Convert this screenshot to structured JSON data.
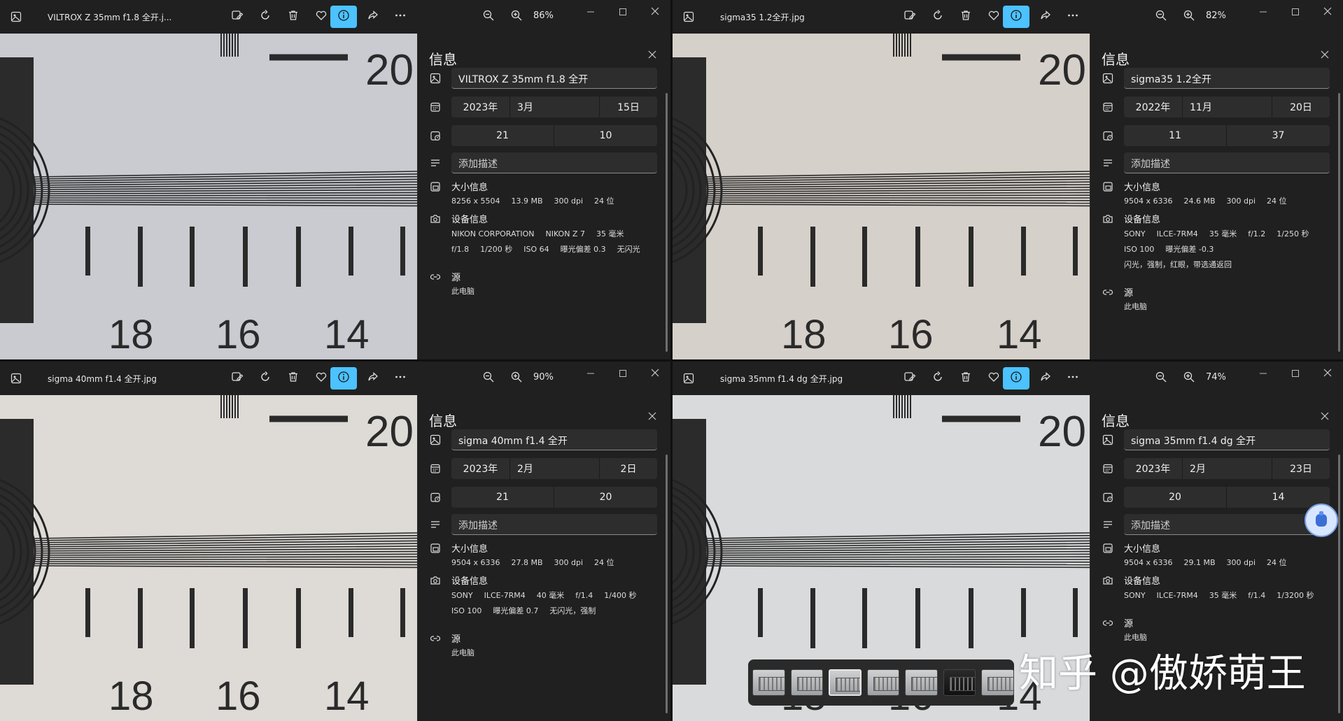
{
  "colors": {
    "accent": "#4cc2ff",
    "window_bg": "#202020",
    "field_bg": "#2d2d2d"
  },
  "windows": [
    {
      "id": "w1",
      "filename": "VILTROX Z 35mm f1.8 全开.j...",
      "zoom": "86%",
      "panel_title": "信息",
      "title_value": "VILTROX Z 35mm f1.8 全开",
      "date": {
        "year": "2023年",
        "month": "3月",
        "day": "15日"
      },
      "time": {
        "hour": "21",
        "minute": "10"
      },
      "description_placeholder": "添加描述",
      "size_title": "大小信息",
      "size_line": [
        "8256 x 5504",
        "13.9 MB",
        "300 dpi",
        "24 位"
      ],
      "device_title": "设备信息",
      "device_lines": [
        [
          "NIKON CORPORATION",
          "NIKON Z 7",
          "35 毫米"
        ],
        [
          "f/1.8",
          "1/200 秒",
          "ISO 64",
          "曝光偏差 0.3",
          "无闪光"
        ]
      ],
      "source_title": "源",
      "source_value": "此电脑",
      "photo_tint": "#c9cbd1",
      "chart_labels": [
        "20",
        "18",
        "16",
        "14"
      ]
    },
    {
      "id": "w2",
      "filename": "sigma35 1.2全开.jpg",
      "zoom": "82%",
      "panel_title": "信息",
      "title_value": "sigma35 1.2全开",
      "date": {
        "year": "2022年",
        "month": "11月",
        "day": "20日"
      },
      "time": {
        "hour": "11",
        "minute": "37"
      },
      "description_placeholder": "添加描述",
      "size_title": "大小信息",
      "size_line": [
        "9504 x 6336",
        "24.6 MB",
        "300 dpi",
        "24 位"
      ],
      "device_title": "设备信息",
      "device_lines": [
        [
          "SONY",
          "ILCE-7RM4",
          "35 毫米",
          "f/1.2",
          "1/250 秒"
        ],
        [
          "ISO 100",
          "曝光偏差 -0.3"
        ],
        [
          "闪光，强制，红眼，带选通返回"
        ]
      ],
      "source_title": "源",
      "source_value": "此电脑",
      "photo_tint": "#d6d0ca",
      "chart_labels": [
        "20",
        "18",
        "16",
        "14"
      ]
    },
    {
      "id": "w3",
      "filename": "sigma 40mm f1.4 全开.jpg",
      "zoom": "90%",
      "panel_title": "信息",
      "title_value": "sigma 40mm f1.4 全开",
      "date": {
        "year": "2023年",
        "month": "2月",
        "day": "2日"
      },
      "time": {
        "hour": "21",
        "minute": "20"
      },
      "description_placeholder": "添加描述",
      "size_title": "大小信息",
      "size_line": [
        "9504 x 6336",
        "27.8 MB",
        "300 dpi",
        "24 位"
      ],
      "device_title": "设备信息",
      "device_lines": [
        [
          "SONY",
          "ILCE-7RM4",
          "40 毫米",
          "f/1.4",
          "1/400 秒"
        ],
        [
          "ISO 100",
          "曝光偏差 0.7",
          "无闪光，强制"
        ]
      ],
      "source_title": "源",
      "source_value": "此电脑",
      "photo_tint": "#dedad6",
      "chart_labels": [
        "20",
        "18",
        "16",
        "14"
      ]
    },
    {
      "id": "w4",
      "filename": "sigma 35mm f1.4 dg 全开.jpg",
      "zoom": "74%",
      "panel_title": "信息",
      "title_value": "sigma 35mm f1.4 dg 全开",
      "date": {
        "year": "2023年",
        "month": "2月",
        "day": "23日"
      },
      "time": {
        "hour": "20",
        "minute": "14"
      },
      "description_placeholder": "添加描述",
      "size_title": "大小信息",
      "size_line": [
        "9504 x 6336",
        "29.1 MB",
        "300 dpi",
        "24 位"
      ],
      "device_title": "设备信息",
      "device_lines": [
        [
          "SONY",
          "ILCE-7RM4",
          "35 毫米",
          "f/1.4",
          "1/3200 秒"
        ]
      ],
      "source_title": "源",
      "source_value": "此电脑",
      "photo_tint": "#d9dadb",
      "chart_labels": [
        "20",
        "18",
        "16",
        "14"
      ]
    }
  ],
  "watermark": "知乎 @傲娇萌王",
  "icons": [
    "image-icon",
    "edit-image-icon",
    "rotate-icon",
    "delete-icon",
    "favorite-icon",
    "info-icon",
    "share-icon",
    "more-icon",
    "zoom-out-icon",
    "zoom-in-icon",
    "minimize-icon",
    "maximize-icon",
    "close-icon",
    "calendar-icon",
    "clock-icon",
    "description-icon",
    "file-size-icon",
    "camera-icon",
    "link-icon"
  ]
}
